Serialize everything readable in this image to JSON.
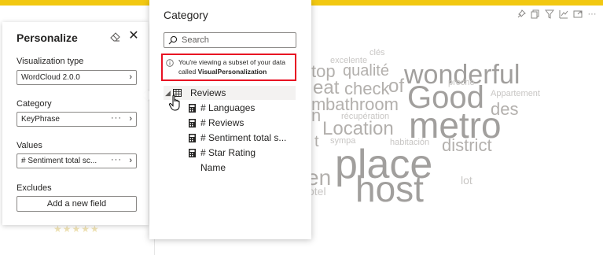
{
  "personalize": {
    "title": "Personalize",
    "visualization_type_label": "Visualization type",
    "visualization_type_value": "WordCloud 2.0.0",
    "category_label": "Category",
    "category_value": "KeyPhrase",
    "values_label": "Values",
    "values_value": "# Sentiment total sc...",
    "excludes_label": "Excludes",
    "add_field_label": "Add a new field",
    "more_glyph": "···",
    "chevron_glyph": "›"
  },
  "category_pane": {
    "title": "Category",
    "search_placeholder": "Search",
    "notice_text": "You're viewing a subset of your data called ",
    "notice_bold": "VisualPersonalization",
    "tree": [
      {
        "label": "Reviews",
        "kind": "table",
        "expanded": true,
        "selected": true
      },
      {
        "label": "# Languages",
        "kind": "measure"
      },
      {
        "label": "# Reviews",
        "kind": "measure"
      },
      {
        "label": "# Sentiment total s...",
        "kind": "measure"
      },
      {
        "label": "# Star Rating",
        "kind": "measure"
      },
      {
        "label": "Name",
        "kind": "field"
      }
    ]
  },
  "visual_header_icons": [
    "pin-icon",
    "copy-icon",
    "filter-icon",
    "insights-icon",
    "focus-mode-icon",
    "more-options-icon"
  ],
  "stars_glyph": "★★★★★",
  "word_cloud": [
    {
      "text": "clés",
      "size": 11,
      "color": "#c8c6c4"
    },
    {
      "text": "excelente",
      "size": 11,
      "color": "#c8c6c4"
    },
    {
      "text": "top",
      "size": 22,
      "color": "#b3b0ad"
    },
    {
      "text": "qualité",
      "size": 20,
      "color": "#b3b0ad"
    },
    {
      "text": "wonderful",
      "size": 34,
      "color": "#a19f9d"
    },
    {
      "text": "proche",
      "size": 11,
      "color": "#c8c6c4"
    },
    {
      "text": "eat",
      "size": 24,
      "color": "#b3b0ad"
    },
    {
      "text": "check",
      "size": 22,
      "color": "#b3b0ad"
    },
    {
      "text": "of",
      "size": 24,
      "color": "#b3b0ad"
    },
    {
      "text": "Good",
      "size": 40,
      "color": "#a19f9d"
    },
    {
      "text": "Appartement",
      "size": 11,
      "color": "#c8c6c4"
    },
    {
      "text": "m",
      "size": 22,
      "color": "#b3b0ad"
    },
    {
      "text": "bathroom",
      "size": 22,
      "color": "#b3b0ad"
    },
    {
      "text": "des",
      "size": 22,
      "color": "#b3b0ad"
    },
    {
      "text": "n",
      "size": 22,
      "color": "#b3b0ad"
    },
    {
      "text": "récupération",
      "size": 11,
      "color": "#c8c6c4"
    },
    {
      "text": "Location",
      "size": 24,
      "color": "#b3b0ad"
    },
    {
      "text": "metro",
      "size": 46,
      "color": "#a19f9d"
    },
    {
      "text": "t",
      "size": 20,
      "color": "#b3b0ad"
    },
    {
      "text": "sympa",
      "size": 11,
      "color": "#c8c6c4"
    },
    {
      "text": "habitación",
      "size": 11,
      "color": "#c8c6c4"
    },
    {
      "text": "district",
      "size": 22,
      "color": "#b3b0ad"
    },
    {
      "text": "place",
      "size": 52,
      "color": "#a19f9d"
    },
    {
      "text": "en",
      "size": 28,
      "color": "#b3b0ad"
    },
    {
      "text": "lot",
      "size": 14,
      "color": "#c8c6c4"
    },
    {
      "text": "host",
      "size": 46,
      "color": "#a19f9d"
    },
    {
      "text": "otel",
      "size": 14,
      "color": "#c8c6c4"
    }
  ]
}
